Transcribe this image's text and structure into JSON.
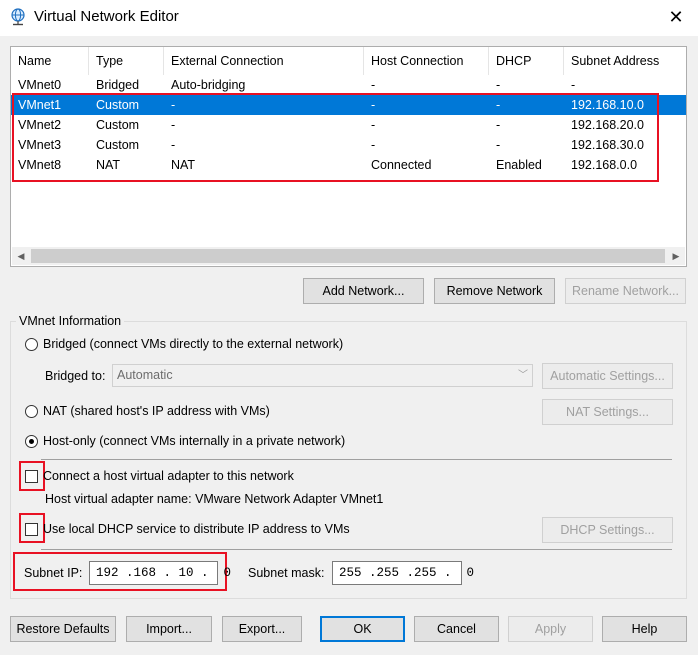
{
  "window": {
    "title": "Virtual Network Editor",
    "close_glyph": "✕"
  },
  "columns": [
    "Name",
    "Type",
    "External Connection",
    "Host Connection",
    "DHCP",
    "Subnet Address"
  ],
  "networks": [
    {
      "name": "VMnet0",
      "type": "Bridged",
      "external": "Auto-bridging",
      "host": "-",
      "dhcp": "-",
      "subnet": "-"
    },
    {
      "name": "VMnet1",
      "type": "Custom",
      "external": "-",
      "host": "-",
      "dhcp": "-",
      "subnet": "192.168.10.0"
    },
    {
      "name": "VMnet2",
      "type": "Custom",
      "external": "-",
      "host": "-",
      "dhcp": "-",
      "subnet": "192.168.20.0"
    },
    {
      "name": "VMnet3",
      "type": "Custom",
      "external": "-",
      "host": "-",
      "dhcp": "-",
      "subnet": "192.168.30.0"
    },
    {
      "name": "VMnet8",
      "type": "NAT",
      "external": "NAT",
      "host": "Connected",
      "dhcp": "Enabled",
      "subnet": "192.168.0.0"
    }
  ],
  "selected_network_index": 1,
  "list_buttons": {
    "add": "Add Network...",
    "remove": "Remove Network",
    "rename": "Rename Network..."
  },
  "vmnet_info": {
    "group_label": "VMnet Information",
    "bridged_label": "Bridged (connect VMs directly to the external network)",
    "bridged_to_label": "Bridged to:",
    "bridged_to_value": "Automatic",
    "auto_settings": "Automatic Settings...",
    "nat_label": "NAT (shared host's IP address with VMs)",
    "nat_settings": "NAT Settings...",
    "hostonly_label": "Host-only (connect VMs internally in a private network)",
    "selected_mode": "host-only",
    "connect_adapter_label": "Connect a host virtual adapter to this network",
    "connect_adapter_checked": false,
    "adapter_name_text": "Host virtual adapter name: VMware Network Adapter VMnet1",
    "dhcp_label": "Use local DHCP service to distribute IP address to VMs",
    "dhcp_checked": false,
    "dhcp_settings": "DHCP Settings...",
    "subnet_ip_label": "Subnet IP:",
    "subnet_ip_value": "192 .168 . 10 .  0",
    "subnet_mask_label": "Subnet mask:",
    "subnet_mask_value": "255 .255 .255 .  0"
  },
  "footer_buttons": {
    "restore": "Restore Defaults",
    "import": "Import...",
    "export": "Export...",
    "ok": "OK",
    "cancel": "Cancel",
    "apply": "Apply",
    "help": "Help"
  },
  "colors": {
    "selection": "#0078d7",
    "highlight_box": "#e81123",
    "window_bg": "#f0f0f0"
  },
  "icons": {
    "title": "network-globe-icon",
    "close": "close-icon",
    "scroll_left": "scroll-left-arrow-icon",
    "scroll_right": "scroll-right-arrow-icon",
    "combo": "chevron-down-icon"
  }
}
